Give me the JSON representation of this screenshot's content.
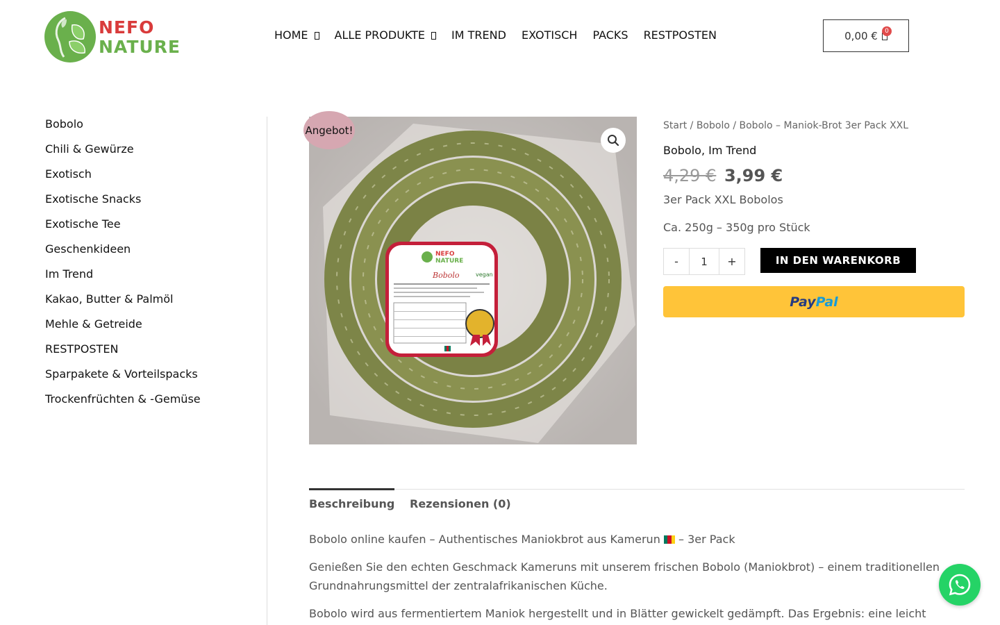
{
  "brand": {
    "line1": "NEFO",
    "line2": "NATURE"
  },
  "nav": {
    "items": [
      {
        "label": "HOME",
        "has_dropdown": true
      },
      {
        "label": "ALLE PRODUKTE",
        "has_dropdown": true
      },
      {
        "label": "IM TREND",
        "has_dropdown": false
      },
      {
        "label": "EXOTISCH",
        "has_dropdown": false
      },
      {
        "label": "PACKS",
        "has_dropdown": false
      },
      {
        "label": "RESTPOSTEN",
        "has_dropdown": false
      }
    ]
  },
  "cart": {
    "total": "0,00 €",
    "count": "0"
  },
  "sidebar": {
    "categories": [
      "Bobolo",
      "Chili & Gewürze",
      "Exotisch",
      "Exotische Snacks",
      "Exotische Tee",
      "Geschenkideen",
      "Im Trend",
      "Kakao, Butter & Palmöl",
      "Mehle & Getreide",
      "RESTPOSTEN",
      "Sparpakete & Vorteilspacks",
      "Trockenfrüchten & -Gemüse"
    ]
  },
  "product": {
    "sale_badge": "Angebot!",
    "label_title": "Bobolo",
    "label_brand_top": "NEFO",
    "label_brand_bottom": "NATURE",
    "label_vegan": "vegan",
    "breadcrumb": "Start / Bobolo / Bobolo – Maniok-Brot 3er Pack XXL",
    "categories": "Bobolo, Im Trend",
    "old_price": "4,29 €",
    "new_price": "3,99 €",
    "short_desc_1": "3er Pack XXL Bobolos",
    "short_desc_2": "Ca. 250g – 350g pro Stück",
    "qty_minus": "-",
    "qty_value": "1",
    "qty_plus": "+",
    "add_to_cart": "IN DEN WARENKORB",
    "paypal_pay": "Pay",
    "paypal_pal": "Pal"
  },
  "tabs": {
    "description": "Beschreibung",
    "reviews": "Rezensionen (0)"
  },
  "description": {
    "p1_before": "Bobolo online kaufen – Authentisches Maniokbrot aus Kamerun",
    "p1_after": "– 3er Pack",
    "p2": "Genießen Sie den echten Geschmack Kameruns mit unserem frischen Bobolo (Maniokbrot) – einem traditionellen Grundnahrungsmittel der zentralafrikanischen Küche.",
    "p3": "Bobolo wird aus fermentiertem Maniok hergestellt und in Blätter gewickelt gedämpft. Das Ergebnis: eine leicht"
  },
  "colors": {
    "brand_green": "#6ab04c",
    "brand_red": "#d93b3b",
    "paypal_yellow": "#ffc439",
    "whatsapp_green": "#25d366",
    "sale_badge": "#d6a7b1"
  },
  "icons": {
    "nav_caret": "chevron-down-icon",
    "cart": "cart-icon",
    "zoom": "magnifier-icon",
    "whatsapp": "whatsapp-icon",
    "flag": "cameroon-flag-icon"
  }
}
